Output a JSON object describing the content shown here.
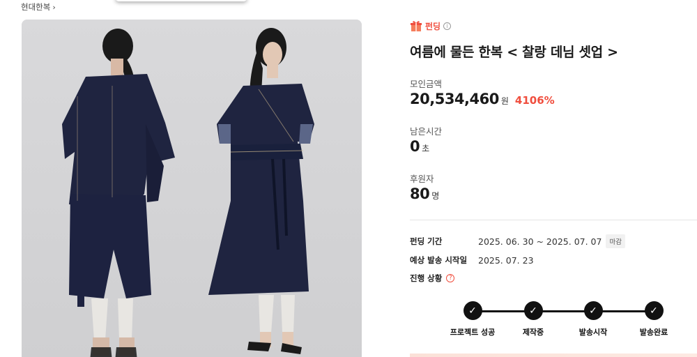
{
  "breadcrumb": {
    "label": "현대한복"
  },
  "project": {
    "category_badge": "펀딩",
    "title": "여름에 물든 한복 < 찰랑 데님 셋업 >"
  },
  "stats": {
    "amount_label": "모인금액",
    "amount_value": "20,534,460",
    "amount_unit": "원",
    "amount_percent": "4106%",
    "time_label": "남은시간",
    "time_value": "0",
    "time_unit": "초",
    "backers_label": "후원자",
    "backers_value": "80",
    "backers_unit": "명"
  },
  "details": {
    "period_label": "펀딩 기간",
    "period_value": "2025. 06. 30 ~ 2025. 07. 07",
    "period_tag": "마감",
    "ship_label": "예상 발송 시작일",
    "ship_value": "2025. 07. 23",
    "status_label": "진행 상황"
  },
  "progress_steps": [
    {
      "label": "프로젝트 성공",
      "done": true
    },
    {
      "label": "제작중",
      "done": true
    },
    {
      "label": "발송시작",
      "done": true
    },
    {
      "label": "발송완료",
      "done": true
    }
  ],
  "colors": {
    "accent": "#f04e3e",
    "denim": "#1f2440",
    "background_photo": "#d5d5d7"
  },
  "icons": [
    "chevron-right-icon",
    "gift-icon",
    "info-icon",
    "help-icon",
    "check-icon"
  ]
}
